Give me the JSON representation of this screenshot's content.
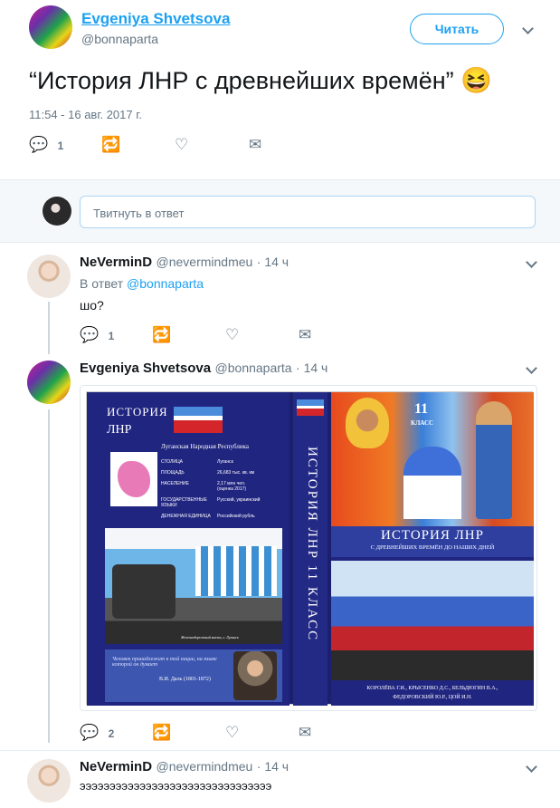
{
  "main_tweet": {
    "author_name": "Evgeniya Shvetsova",
    "author_handle": "@bonnaparta",
    "follow_button": "Читать",
    "text": "“История ЛНР с древнейших времён”",
    "emoji": "😆",
    "timestamp": "11:54 - 16 авг. 2017 г.",
    "reply_count": "1"
  },
  "reply_box": {
    "placeholder": "Твитнуть в ответ"
  },
  "replies": [
    {
      "author_name": "NeVerminD",
      "author_handle": "@nevermindmeu",
      "time": "· 14 ч",
      "in_reply_prefix": "В ответ",
      "in_reply_handle": "@bonnaparta",
      "text": "шо?",
      "reply_count": "1"
    },
    {
      "author_name": "Evgeniya Shvetsova",
      "author_handle": "@bonnaparta",
      "time": "· 14 ч",
      "reply_count": "2",
      "cover": {
        "title_line1": "ИСТОРИЯ",
        "title_line2": "ЛНР",
        "republic": "Луганская Народная Республика",
        "facts": [
          {
            "k": "СТОЛИЦА",
            "v": "Луганск"
          },
          {
            "k": "ПЛОЩАДЬ",
            "v": "26,683 тыс. кв. км"
          },
          {
            "k": "НАСЕЛЕНИЕ",
            "v": "2,17 млн чел. (оценка 2017)"
          },
          {
            "k": "ГОСУДАРСТВЕННЫЕ ЯЗЫКИ",
            "v": "Русский, украинский"
          },
          {
            "k": "ДЕНЕЖНАЯ ЕДИНИЦА",
            "v": "Российский рубль"
          }
        ],
        "photo_caption": "Железнодорожный вокзал, г. Луганск",
        "quote": "Человек принадлежит к той нации, на языке которой он думает",
        "quote_author": "В.И. Даль (1801-1872)",
        "spine": "ИСТОРИЯ ЛНР 11 КЛАСС",
        "grade": "11",
        "grade_word": "КЛАСС",
        "right_title": "ИСТОРИЯ ЛНР",
        "right_subtitle": "С ДРЕВНЕЙШИХ ВРЕМЁН ДО НАШИХ ДНЕЙ",
        "authors_line1": "КОРОЛЁВА Г.И., КРЫСЕНКО Д.С., БЕЛЬДЮГИН В.А.,",
        "authors_line2": "ФЕДОРОВСКИЙ Ю.Р., ЦОЙ И.Н."
      }
    },
    {
      "author_name": "NeVerminD",
      "author_handle": "@nevermindmeu",
      "time": "· 14 ч",
      "text": "ээээээээээээээээээээээээээээээээ"
    }
  ]
}
